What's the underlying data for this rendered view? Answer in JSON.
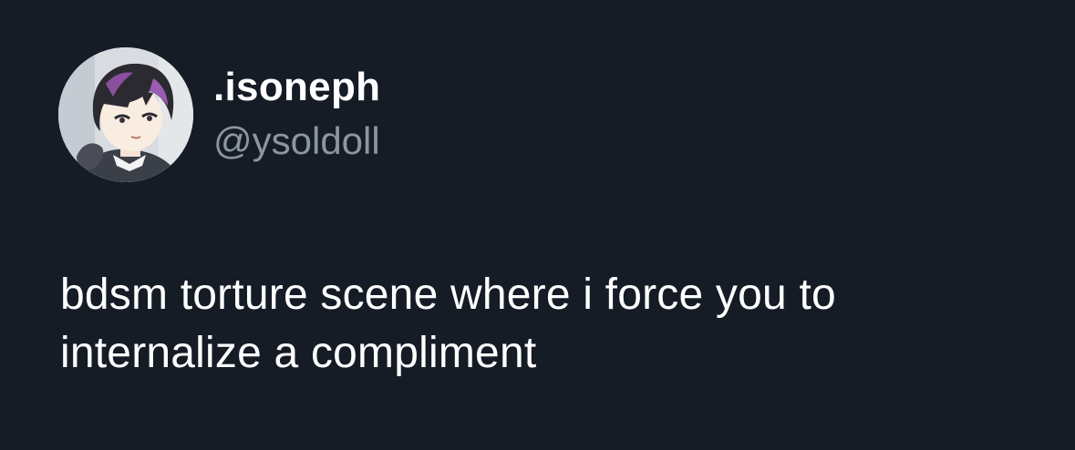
{
  "author": {
    "display_name": ".isoneph",
    "handle": "@ysoldoll",
    "avatar": "profile-avatar"
  },
  "tweet": {
    "text": "bdsm torture scene where i force you to internalize a compliment"
  },
  "colors": {
    "background": "#151c26",
    "name": "#ffffff",
    "handle": "#8b96a1",
    "text": "#ffffff"
  }
}
